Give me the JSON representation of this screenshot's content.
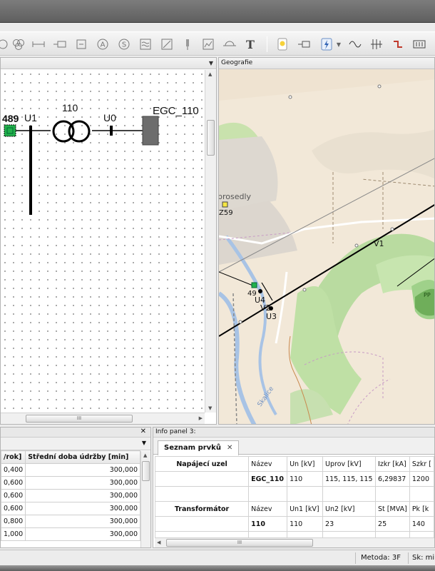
{
  "toolbar": {
    "icons": [
      "circle-cross-icon",
      "triple-circle-icon",
      "line-segment-icon",
      "switch-icon",
      "box-minus-icon",
      "a-circle-icon",
      "s-circle-icon",
      "wave-icon",
      "diagonal-box-icon",
      "pin-icon",
      "chart-box-icon",
      "undo-arc-icon",
      "text-tool-icon",
      "bulb-icon",
      "resistor-icon",
      "lightning-icon",
      "dropdown-arrow-icon",
      "sine-wave-icon",
      "phase-icon",
      "shift-icon",
      "battery-icon"
    ],
    "text_tool_label": "T"
  },
  "schema": {
    "node_label": "489",
    "bus_label": "U1",
    "transformer_label": "110",
    "u0_label": "U0",
    "source_label": "EGC_110",
    "colors": {
      "node_fill": "#22b14c"
    }
  },
  "map": {
    "title": "Geografie",
    "labels": {
      "town": "prosedly",
      "z59": "Z59",
      "v1": "V1",
      "n49": "49",
      "u4": "U4",
      "v2": "V2",
      "u3": "U3",
      "river": "Skalice",
      "pp": "PP"
    }
  },
  "bottom_left": {
    "headers": [
      "/rok]",
      "Střední doba údržby [min]"
    ],
    "rows": [
      [
        "0,400",
        "300,000"
      ],
      [
        "0,600",
        "300,000"
      ],
      [
        "0,600",
        "300,000"
      ],
      [
        "0,600",
        "300,000"
      ],
      [
        "0,800",
        "300,000"
      ],
      [
        "1,000",
        "300,000"
      ]
    ],
    "close_label": "✕",
    "scroll_label": "III"
  },
  "info_panel": {
    "title": "Info panel 3:",
    "tab_label": "Seznam prvků",
    "tab_close": "✕",
    "rows": [
      [
        "Napájecí uzel",
        "Název",
        "Un [kV]",
        "Uprov [kV]",
        "Izkr [kA]",
        "Szkr ["
      ],
      [
        "",
        "EGC_110",
        "110",
        "115, 115, 115",
        "6,29837",
        "1200"
      ],
      [
        "",
        "",
        "",
        "",
        "",
        ""
      ],
      [
        "Transformátor",
        "Název",
        "Un1 [kV]",
        "Un2 [kV]",
        "St [MVA]",
        "Pk [k"
      ],
      [
        "",
        "110",
        "110",
        "23",
        "25",
        "140"
      ],
      [
        "",
        "",
        "",
        "",
        "",
        ""
      ]
    ],
    "scroll_label": "III"
  },
  "status": {
    "method": "Metoda: 3F",
    "sk": "Sk: mi"
  },
  "left_panel": {
    "scroll_label": "III"
  }
}
